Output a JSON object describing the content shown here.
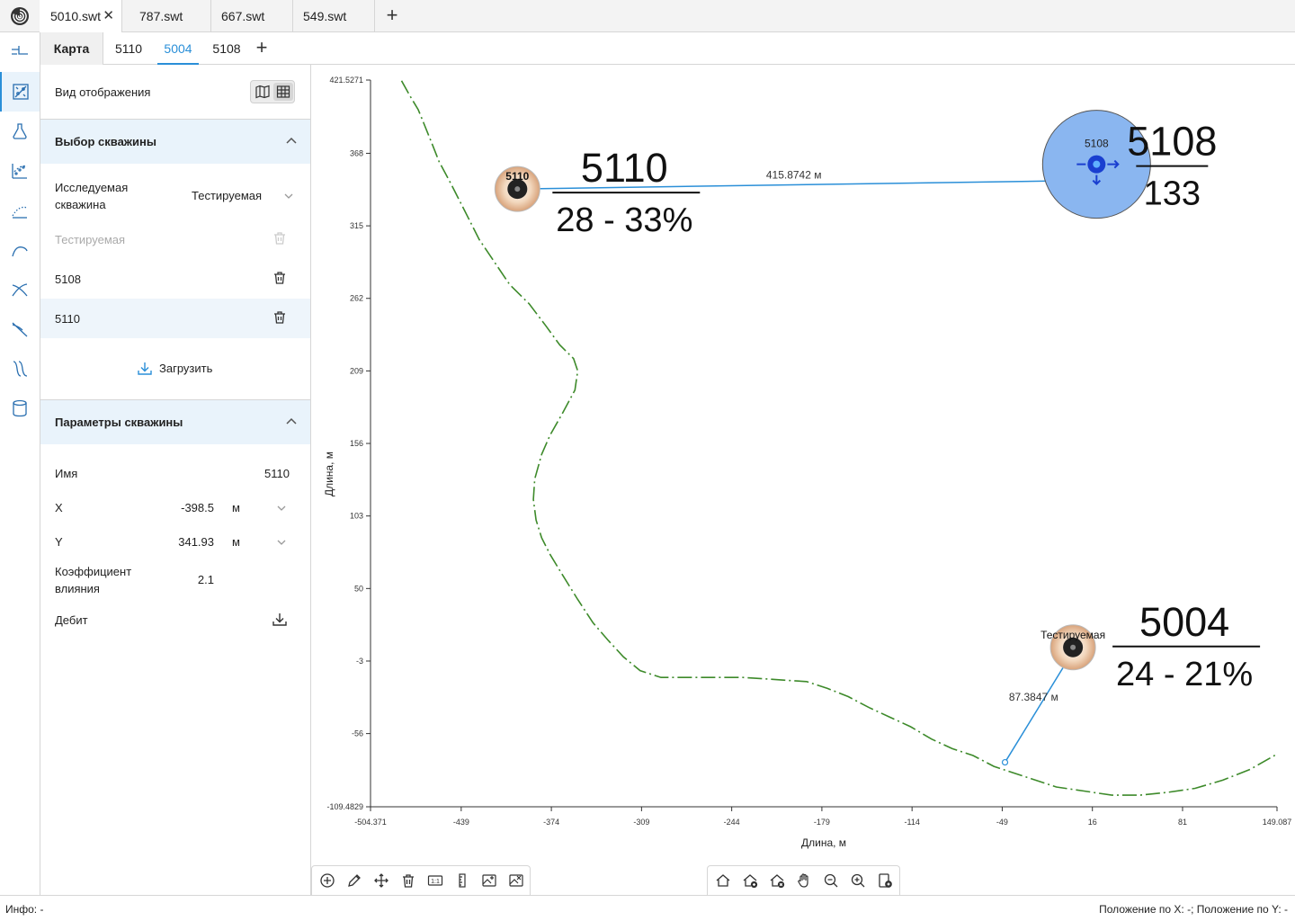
{
  "file_tabs": [
    {
      "label": "5010.swt",
      "active": true
    },
    {
      "label": "787.swt"
    },
    {
      "label": "667.swt"
    },
    {
      "label": "549.swt"
    }
  ],
  "sub_tabs": {
    "karta": "Карта",
    "wells": [
      "5110",
      "5004",
      "5108"
    ],
    "active_index": 1
  },
  "panel": {
    "view_mode_label": "Вид отображения",
    "well_selection": {
      "title": "Выбор скважины",
      "studied_label": "Исследуемая скважина",
      "studied_value": "Тестируемая",
      "placeholder_item": "Тестируемая",
      "items": [
        "5108",
        "5110"
      ],
      "load_label": "Загрузить"
    },
    "well_params": {
      "title": "Параметры скважины",
      "name_label": "Имя",
      "name_value": "5110",
      "x_label": "X",
      "x_value": "-398.5",
      "x_unit": "м",
      "y_label": "Y",
      "y_value": "341.93",
      "y_unit": "м",
      "coef_label": "Коэффициент влияния",
      "coef_value": "2.1",
      "debit_label": "Дебит"
    }
  },
  "map": {
    "x_axis_label": "Длина, м",
    "y_axis_label": "Длина, м",
    "x_ticks": [
      "-504.371",
      "-439",
      "-374",
      "-309",
      "-244",
      "-179",
      "-114",
      "-49",
      "16",
      "81",
      "149.087"
    ],
    "y_ticks": [
      "421.5271",
      "368",
      "315",
      "262",
      "209",
      "156",
      "103",
      "50",
      "-3",
      "-56",
      "-109.4829"
    ],
    "x_range": [
      -504.371,
      149.087
    ],
    "y_range": [
      -109.4829,
      421.5271
    ],
    "wells": [
      {
        "name": "5110",
        "x": -398.5,
        "y": 341.93,
        "big_label": "5110",
        "sub_label": "28 - 33%"
      },
      {
        "name": "5108",
        "x": 19,
        "y": 360,
        "big_label": "5108",
        "sub_label": "133"
      },
      {
        "name": "Тестируемая",
        "x": 2,
        "y": 7,
        "big_label": "5004",
        "sub_label": "24 - 21%"
      }
    ],
    "measurements": [
      {
        "label": "415.8742 м",
        "from": [
          -398.5,
          341.93
        ],
        "to": [
          0,
          348
        ]
      },
      {
        "label": "87.3847 м",
        "from": [
          2,
          4
        ],
        "to": [
          -47,
          -77
        ]
      }
    ],
    "boundary_points": [
      [
        -482,
        421
      ],
      [
        -476,
        410
      ],
      [
        -470,
        400
      ],
      [
        -466,
        390
      ],
      [
        -460,
        375
      ],
      [
        -455,
        362
      ],
      [
        -446,
        345
      ],
      [
        -436,
        325
      ],
      [
        -426,
        305
      ],
      [
        -416,
        290
      ],
      [
        -404,
        272
      ],
      [
        -390,
        258
      ],
      [
        -378,
        242
      ],
      [
        -368,
        228
      ],
      [
        -358,
        218
      ],
      [
        -355,
        209
      ],
      [
        -357,
        195
      ],
      [
        -366,
        178
      ],
      [
        -375,
        162
      ],
      [
        -381,
        148
      ],
      [
        -386,
        130
      ],
      [
        -387,
        115
      ],
      [
        -385,
        100
      ],
      [
        -381,
        87
      ],
      [
        -375,
        75
      ],
      [
        -366,
        60
      ],
      [
        -355,
        42
      ],
      [
        -344,
        25
      ],
      [
        -333,
        12
      ],
      [
        -322,
        0
      ],
      [
        -310,
        -10
      ],
      [
        -295,
        -15
      ],
      [
        -275,
        -15
      ],
      [
        -255,
        -15
      ],
      [
        -236,
        -15
      ],
      [
        -220,
        -16
      ],
      [
        -205,
        -17
      ],
      [
        -190,
        -18
      ],
      [
        -175,
        -23
      ],
      [
        -160,
        -29
      ],
      [
        -145,
        -37
      ],
      [
        -130,
        -44
      ],
      [
        -115,
        -51
      ],
      [
        -100,
        -60
      ],
      [
        -85,
        -67
      ],
      [
        -70,
        -72
      ],
      [
        -55,
        -80
      ],
      [
        -40,
        -85
      ],
      [
        -25,
        -90
      ],
      [
        -10,
        -95
      ],
      [
        10,
        -98
      ],
      [
        30,
        -101
      ],
      [
        50,
        -101
      ],
      [
        70,
        -99
      ],
      [
        90,
        -96
      ],
      [
        110,
        -90
      ],
      [
        130,
        -82
      ],
      [
        149,
        -71
      ]
    ]
  },
  "status": {
    "info": "Инфо: -",
    "position": "Положение по X: -; Положение по Y: -"
  },
  "colors": {
    "accent": "#2a8fd8",
    "boundary": "#3d8a2a",
    "bubble_5108": "#8ab6f0"
  }
}
